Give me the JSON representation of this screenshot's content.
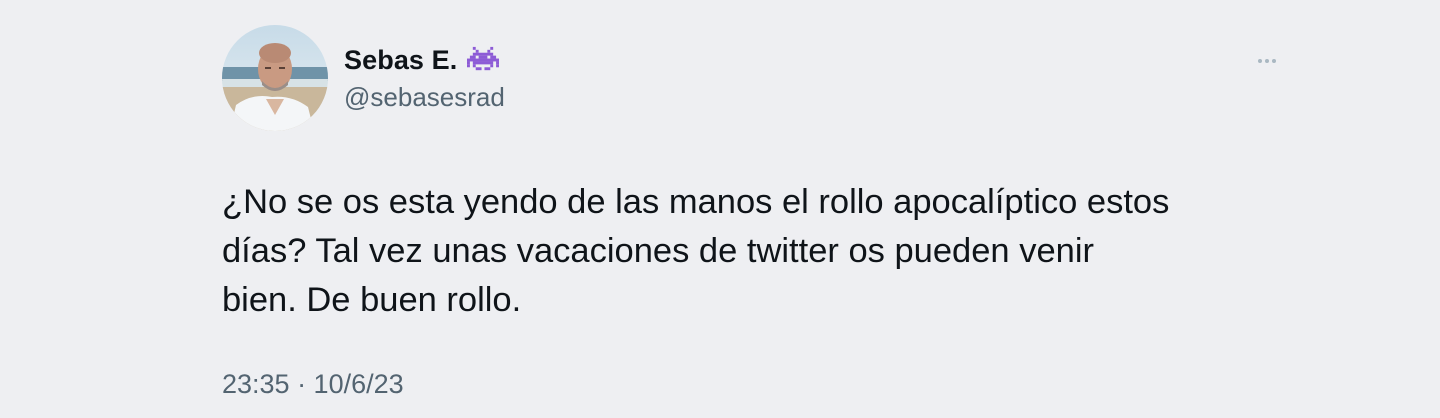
{
  "author": {
    "name": "Sebas E.",
    "handle": "@sebasesrad",
    "badge_icon": "space-invader-icon",
    "avatar_icon": "profile-photo"
  },
  "tweet": {
    "text": "¿No se os esta yendo de las manos el rollo apocalíptico estos\ndías? Tal vez unas vacaciones de twitter os pueden venir\nbien. De buen rollo.",
    "timestamp": "23:35 · 10/6/23"
  },
  "menu": {
    "icon": "more-icon"
  },
  "colors": {
    "background": "#eeeff2",
    "primary_text": "#0f1419",
    "secondary_text": "#536471",
    "badge_purple": "#8d5bd6"
  }
}
